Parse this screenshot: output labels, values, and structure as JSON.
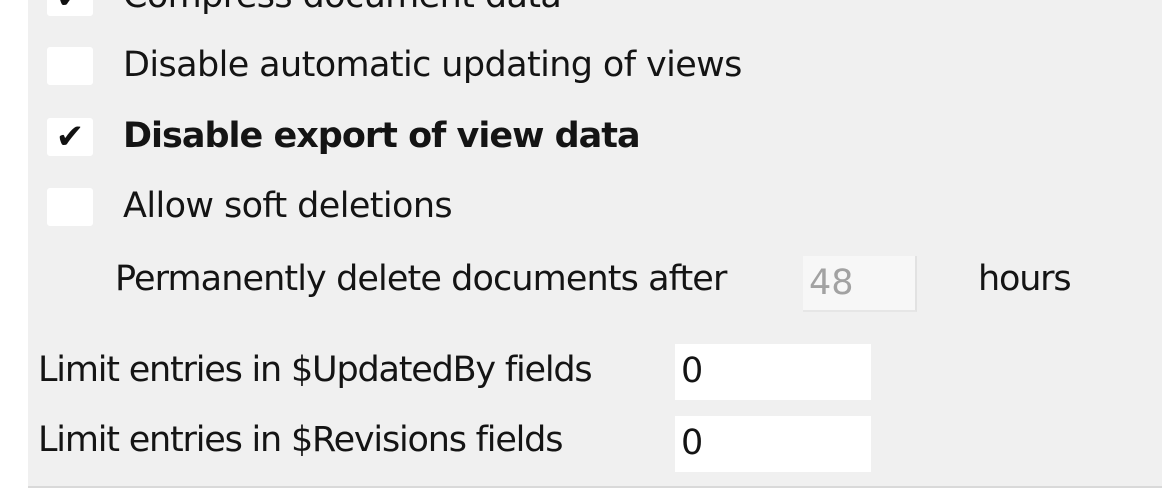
{
  "options": {
    "compress": {
      "label": "Compress document data",
      "checked": true
    },
    "disable_auto_update": {
      "label": "Disable automatic updating of views",
      "checked": false
    },
    "disable_export": {
      "label": "Disable export of view data",
      "checked": true
    },
    "soft_deletions": {
      "label": "Allow soft deletions",
      "checked": false
    }
  },
  "soft_delete": {
    "label": "Permanently delete documents after",
    "value": "48",
    "unit": "hours"
  },
  "updated_by": {
    "label": "Limit entries in $UpdatedBy fields",
    "value": "0"
  },
  "revisions": {
    "label": "Limit entries in $Revisions fields",
    "value": "0"
  },
  "icons": {
    "check": "✔"
  }
}
